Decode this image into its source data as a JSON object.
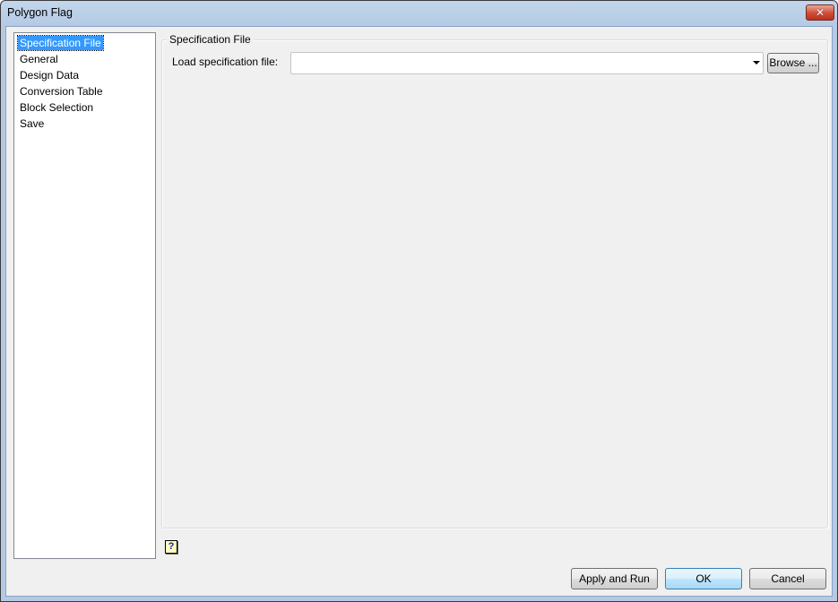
{
  "window": {
    "title": "Polygon Flag",
    "close_label": "✕"
  },
  "nav": {
    "items": [
      {
        "label": "Specification File",
        "selected": true
      },
      {
        "label": "General",
        "selected": false
      },
      {
        "label": "Design Data",
        "selected": false
      },
      {
        "label": "Conversion Table",
        "selected": false
      },
      {
        "label": "Block Selection",
        "selected": false
      },
      {
        "label": "Save",
        "selected": false
      }
    ]
  },
  "panel": {
    "group_title": "Specification File",
    "load_label": "Load specification file:",
    "load_value": "",
    "browse_label": "Browse ..."
  },
  "footer": {
    "help_glyph": "?",
    "apply_label": "Apply and Run",
    "ok_label": "OK",
    "cancel_label": "Cancel"
  }
}
